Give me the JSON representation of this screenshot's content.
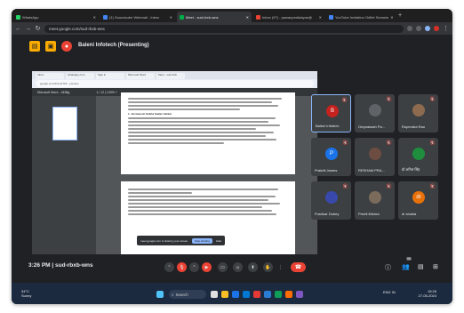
{
  "browser": {
    "tabs": [
      {
        "label": "WhatsApp",
        "color": "#25d366",
        "active": false
      },
      {
        "label": "(1) Soundcube Webmail - Inbox",
        "color": "#4285f4",
        "active": false
      },
      {
        "label": "Meet - sud-rbxb-wns",
        "color": "#00ac47",
        "active": true
      },
      {
        "label": "Inbox (97) - pawanpeddatyan@",
        "color": "#ea4335",
        "active": false
      },
      {
        "label": "YouTube Invitation Oriflet Semmis",
        "color": "#4285f4",
        "active": false
      }
    ],
    "url": "meet.google.com/sud-rbxb-wns",
    "new_tab": "+"
  },
  "meet": {
    "presenting_label": "Baleni Infotech (Presenting)",
    "time": "3:26 PM",
    "meeting_code": "sud-rbxb-wns",
    "participant_count": "10"
  },
  "shared": {
    "tabs": [
      "Inbox",
      "whatsapp.com",
      "Sign in",
      "Microsoft Word",
      "Meet - sud-rbxb"
    ],
    "url": "google.com/drive/2718 - preview",
    "doc_title": "Microsoft Word - 4498g",
    "zoom": "1 / 12    |    100%    +",
    "page_heading": "1. Jai Ganesh Sabha Sadan Sarkar",
    "taskbar_search": "Type here to search",
    "toast_text": "meet.google.com is sharing your screen.",
    "toast_button": "Stop sharing",
    "toast_hide": "Hide",
    "taskbar_time": "3:26 PM",
    "taskbar_date": "27-Dec-21"
  },
  "participants": [
    {
      "name": "Baleni Infotech",
      "initial": "B",
      "color": "#c5221f",
      "highlight": true
    },
    {
      "name": "Omprakash Pa...",
      "initial": "",
      "color": "#5f6368",
      "highlight": false
    },
    {
      "name": "Rupendra Rao",
      "initial": "",
      "color": "#8e6b4f",
      "highlight": false
    },
    {
      "name": "Prakriti James",
      "initial": "P",
      "color": "#1a73e8",
      "highlight": false
    },
    {
      "name": "RESHAM PRA...",
      "initial": "",
      "color": "#6d4c41",
      "highlight": false
    },
    {
      "name": "डॉ अनिल सिंह",
      "initial": "",
      "color": "#1e8e3e",
      "highlight": false
    },
    {
      "name": "Pushkar Dubey",
      "initial": "",
      "color": "#3949ab",
      "highlight": false
    },
    {
      "name": "Preeti Mishra",
      "initial": "",
      "color": "#7b6b5b",
      "highlight": false
    },
    {
      "name": "dr shukla",
      "initial": "dr",
      "color": "#e8710a",
      "highlight": false
    }
  ],
  "windows": {
    "search": "Search",
    "weather_temp": "34°C",
    "weather_desc": "Sunny",
    "lang": "ENG IN",
    "time": "15:26",
    "date": "27-05-2024"
  }
}
